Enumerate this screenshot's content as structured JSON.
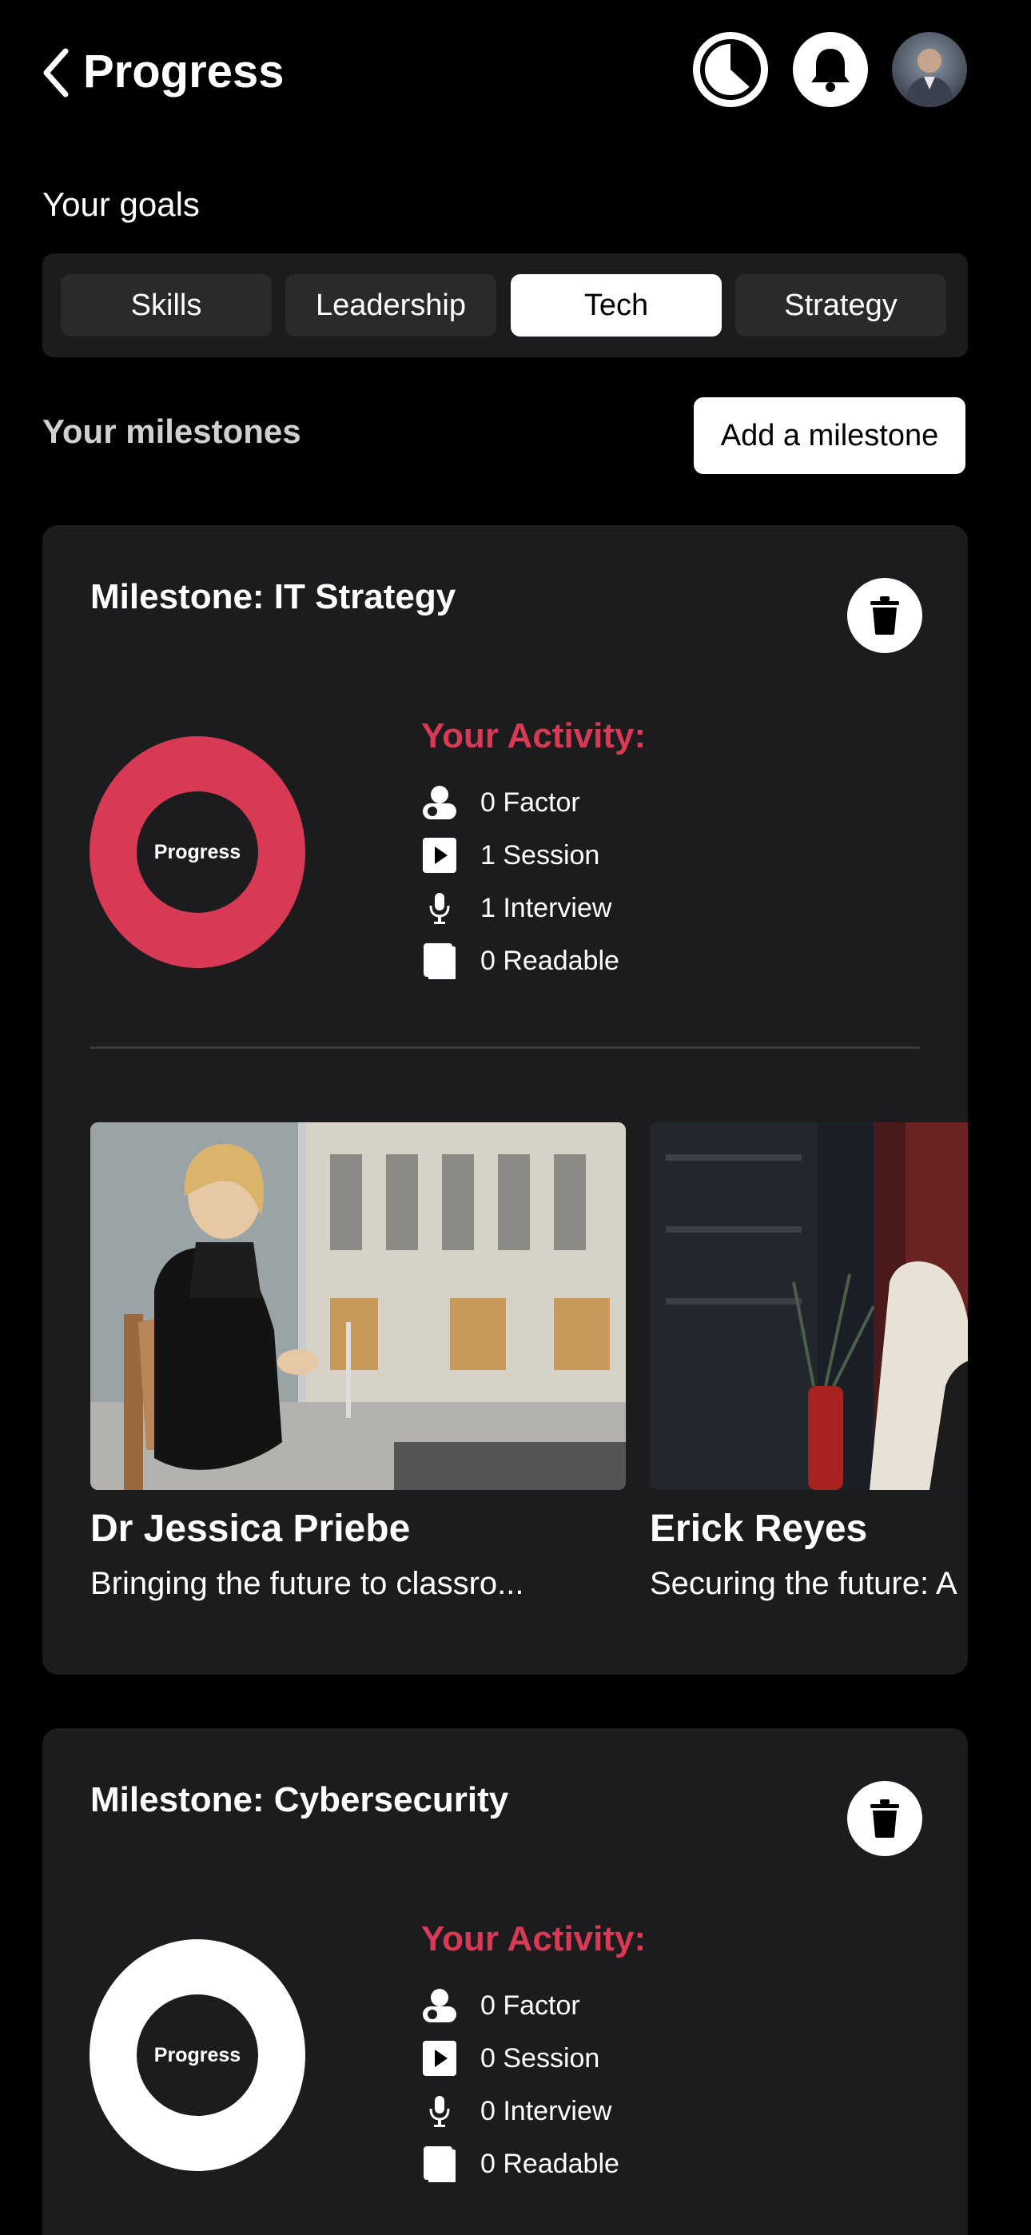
{
  "header": {
    "title": "Progress"
  },
  "goals": {
    "label": "Your goals",
    "tabs": [
      "Skills",
      "Leadership",
      "Tech",
      "Strategy"
    ],
    "active_tab": "Tech"
  },
  "milestones": {
    "label": "Your milestones",
    "add_button": "Add a milestone",
    "items": [
      {
        "title": "Milestone: IT Strategy",
        "progress_label": "Progress",
        "ring_color": "#d83a55",
        "activity_title": "Your Activity:",
        "activity": [
          "0 Factor",
          "1 Session",
          "1 Interview",
          "0 Readable"
        ],
        "videos": [
          {
            "name": "Dr Jessica Priebe",
            "desc": "Bringing the future to classro..."
          },
          {
            "name": "Erick Reyes",
            "desc": "Securing the future: A"
          }
        ]
      },
      {
        "title": "Milestone: Cybersecurity",
        "progress_label": "Progress",
        "ring_color": "#ffffff",
        "activity_title": "Your Activity:",
        "activity": [
          "0 Factor",
          "0 Session",
          "0 Interview",
          "0 Readable"
        ]
      }
    ]
  },
  "colors": {
    "accent": "#d83a55",
    "card": "#1c1c1e",
    "background": "#000000"
  },
  "icons": [
    "chevron-left-icon",
    "clock-icon",
    "bell-icon",
    "trash-icon",
    "factor-icon",
    "play-icon",
    "microphone-icon",
    "book-icon"
  ]
}
